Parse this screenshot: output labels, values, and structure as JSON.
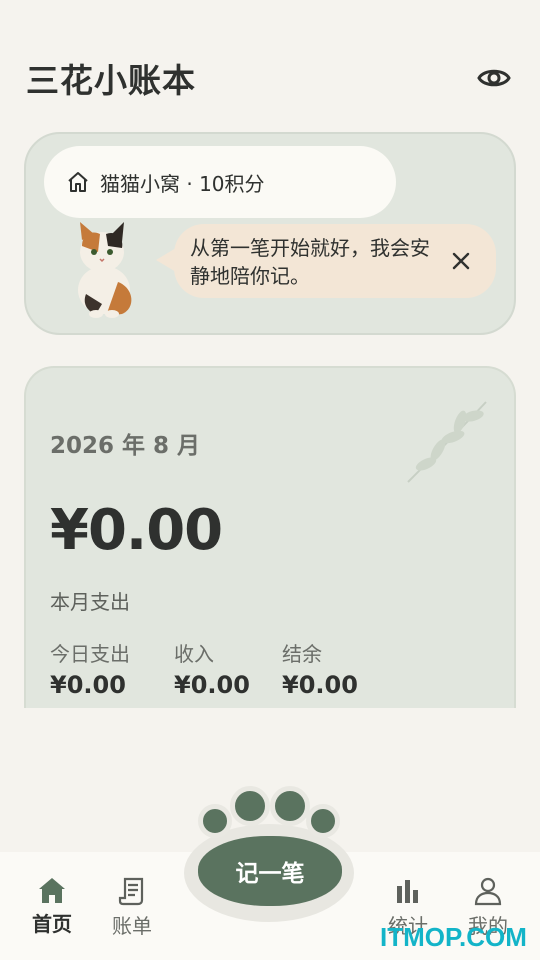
{
  "header": {
    "title": "三花小账本",
    "visibility_icon": "eye-icon"
  },
  "cat_card": {
    "home_icon": "home-icon",
    "home_text": "猫猫小窝 · 10积分",
    "bubble_text": "从第一笔开始就好，我会安静地陪你记。",
    "close_icon": "close-icon"
  },
  "month_card": {
    "month": "2026 年 8 月",
    "amount": "¥0.00",
    "amount_label": "本月支出",
    "stats": [
      {
        "label": "今日支出",
        "value": "¥0.00"
      },
      {
        "label": "收入",
        "value": "¥0.00"
      },
      {
        "label": "结余",
        "value": "¥0.00"
      }
    ]
  },
  "nav": {
    "items": [
      {
        "label": "首页",
        "icon": "home-icon",
        "active": true
      },
      {
        "label": "账单",
        "icon": "receipt-icon",
        "active": false
      },
      {
        "label": "统计",
        "icon": "bar-chart-icon",
        "active": false
      },
      {
        "label": "我的",
        "icon": "person-icon",
        "active": false
      }
    ],
    "record_button": "记一笔"
  },
  "watermark": "ITMOP.COM",
  "colors": {
    "accent": "#5a735f",
    "card": "#e1e6de",
    "bubble": "#f3e6d6",
    "background": "#f5f3ee"
  }
}
